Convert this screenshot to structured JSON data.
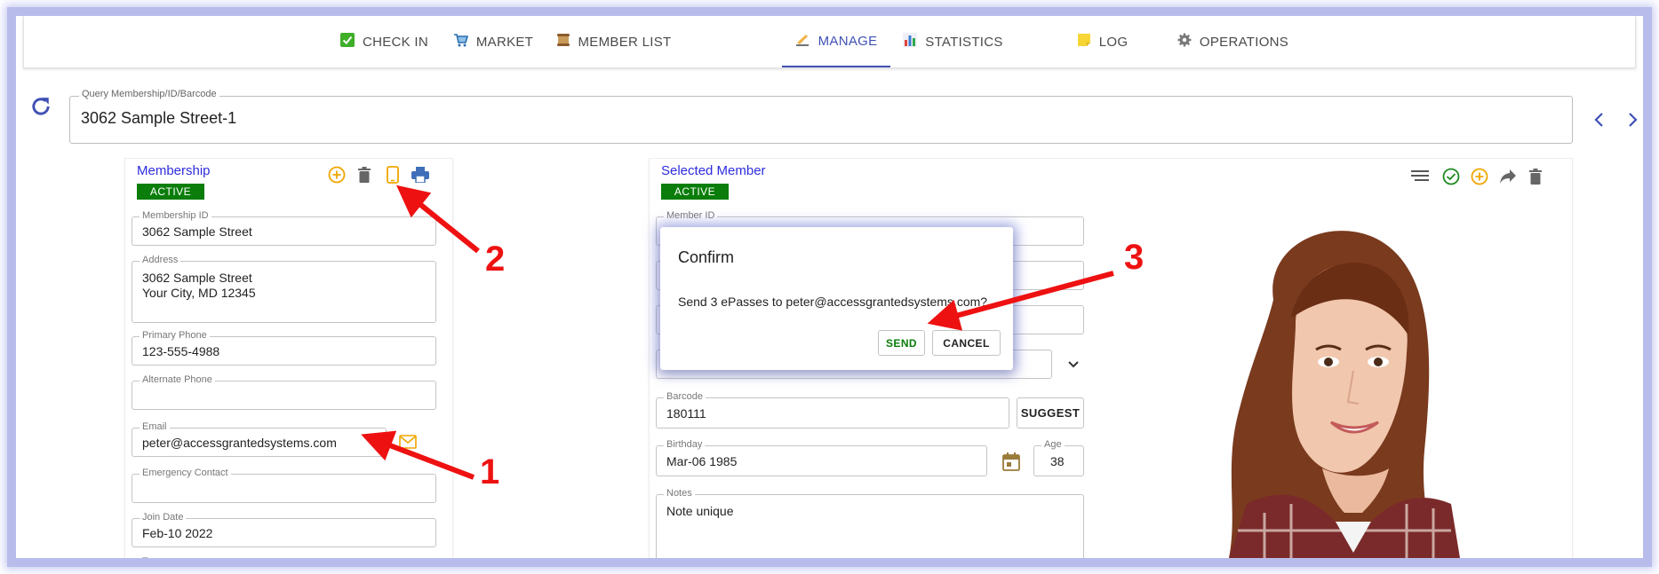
{
  "tabs": [
    {
      "label": "CHECK IN",
      "icon": "check-box-icon"
    },
    {
      "label": "MARKET",
      "icon": "cart-icon"
    },
    {
      "label": "MEMBER LIST",
      "icon": "scroll-icon"
    },
    {
      "label": "MANAGE",
      "icon": "writing-hand-icon",
      "active": true
    },
    {
      "label": "STATISTICS",
      "icon": "bar-chart-icon"
    },
    {
      "label": "LOG",
      "icon": "note-icon"
    },
    {
      "label": "OPERATIONS",
      "icon": "gear-icon"
    }
  ],
  "query": {
    "label": "Query Membership/ID/Barcode",
    "value": "3062 Sample Street-1"
  },
  "membership": {
    "title": "Membership",
    "status": "ACTIVE",
    "fields": {
      "membership_id": {
        "label": "Membership ID",
        "value": "3062 Sample Street"
      },
      "address": {
        "label": "Address",
        "value": "3062 Sample Street\nYour City, MD 12345"
      },
      "primary_phone": {
        "label": "Primary Phone",
        "value": "123-555-4988"
      },
      "alternate_phone": {
        "label": "Alternate Phone",
        "value": ""
      },
      "email": {
        "label": "Email",
        "value": "peter@accessgrantedsystems.com"
      },
      "emergency_contact": {
        "label": "Emergency Contact",
        "value": ""
      },
      "join_date": {
        "label": "Join Date",
        "value": "Feb-10 2022"
      },
      "type": {
        "label": "Type"
      }
    }
  },
  "member": {
    "title": "Selected Member",
    "status": "ACTIVE",
    "fields": {
      "member_id": {
        "label": "Member ID"
      },
      "barcode": {
        "label": "Barcode",
        "value": "180111"
      },
      "birthday": {
        "label": "Birthday",
        "value": "Mar-06 1985"
      },
      "age": {
        "label": "Age",
        "value": "38"
      },
      "notes": {
        "label": "Notes",
        "value": "Note unique"
      }
    },
    "suggest_label": "SUGGEST"
  },
  "dialog": {
    "title": "Confirm",
    "message": "Send 3 ePasses to peter@accessgrantedsystems.com?",
    "send_label": "SEND",
    "cancel_label": "CANCEL"
  },
  "annotations": {
    "one": "1",
    "two": "2",
    "three": "3"
  },
  "colors": {
    "accent": "#3f51b5",
    "active_badge": "#0a7d0a",
    "amber": "#f0a500",
    "annotation": "#ee1111",
    "send": "#0a7d0a"
  }
}
